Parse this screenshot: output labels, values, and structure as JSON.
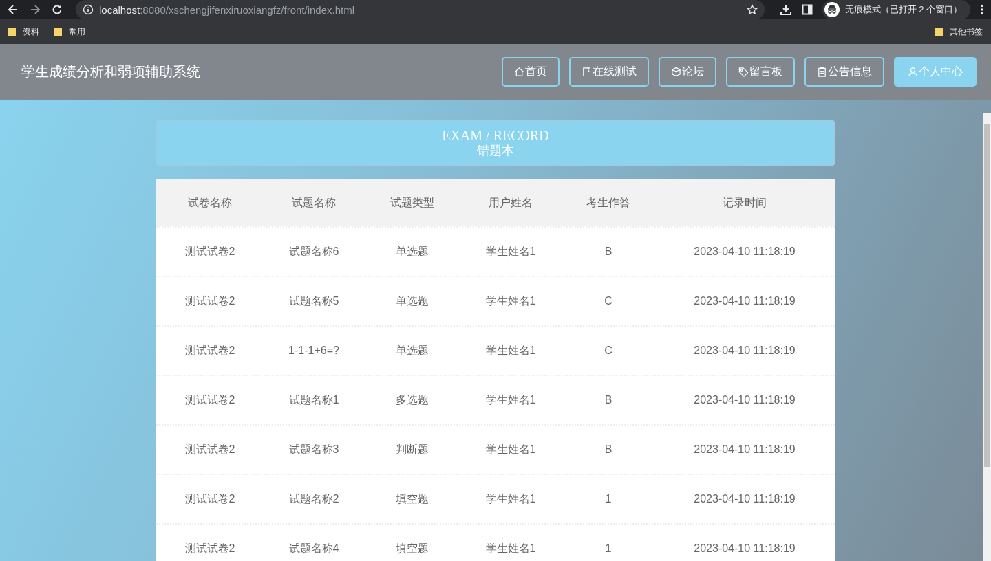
{
  "browser": {
    "url_host": "localhost",
    "url_rest": ":8080/xschengjifenxiruoxiangfz/front/index.html",
    "incognito_label": "无痕模式（已打开 2 个窗口）",
    "bookmarks": [
      "资料",
      "常用"
    ],
    "other_bookmarks": "其他书签"
  },
  "header": {
    "title": "学生成绩分析和弱项辅助系统",
    "nav": [
      {
        "label": "首页",
        "kind": "home",
        "selected": false
      },
      {
        "label": "在线测试",
        "kind": "flag",
        "selected": false
      },
      {
        "label": "论坛",
        "kind": "cube",
        "selected": false
      },
      {
        "label": "留言板",
        "kind": "tag",
        "selected": false
      },
      {
        "label": "公告信息",
        "kind": "clipboard",
        "selected": false
      },
      {
        "label": "个人中心",
        "kind": "user",
        "selected": true
      }
    ]
  },
  "banner": {
    "subtitle": "EXAM / RECORD",
    "title": "错题本"
  },
  "table": {
    "columns": [
      "试卷名称",
      "试题名称",
      "试题类型",
      "用户姓名",
      "考生作答",
      "记录时间"
    ],
    "rows": [
      [
        "测试试卷2",
        "试题名称6",
        "单选题",
        "学生姓名1",
        "B",
        "2023-04-10 11:18:19"
      ],
      [
        "测试试卷2",
        "试题名称5",
        "单选题",
        "学生姓名1",
        "C",
        "2023-04-10 11:18:19"
      ],
      [
        "测试试卷2",
        "1-1-1+6=?",
        "单选题",
        "学生姓名1",
        "C",
        "2023-04-10 11:18:19"
      ],
      [
        "测试试卷2",
        "试题名称1",
        "多选题",
        "学生姓名1",
        "B",
        "2023-04-10 11:18:19"
      ],
      [
        "测试试卷2",
        "试题名称3",
        "判断题",
        "学生姓名1",
        "B",
        "2023-04-10 11:18:19"
      ],
      [
        "测试试卷2",
        "试题名称2",
        "填空题",
        "学生姓名1",
        "1",
        "2023-04-10 11:18:19"
      ],
      [
        "测试试卷2",
        "试题名称4",
        "填空题",
        "学生姓名1",
        "1",
        "2023-04-10 11:18:19"
      ]
    ]
  }
}
